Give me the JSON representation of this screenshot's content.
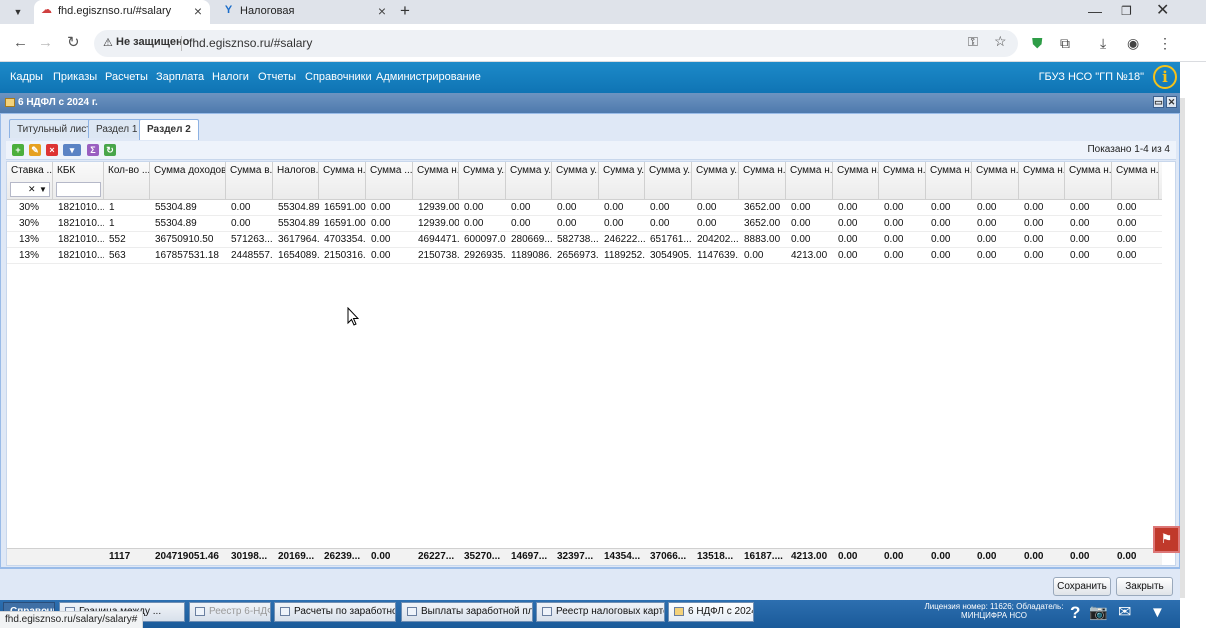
{
  "browser": {
    "tabs": [
      {
        "title": "fhd.egisznso.ru/#salary",
        "active": true
      },
      {
        "title": "Налоговая",
        "active": false
      }
    ],
    "url": "fhd.egisznso.ru/#salary",
    "security_label": "Не защищено",
    "status_url": "fhd.egisznso.ru/salary/salary#"
  },
  "menu": {
    "items": [
      "Кадры",
      "Приказы",
      "Расчеты",
      "Зарплата",
      "Налоги",
      "Отчеты",
      "Справочники",
      "Администрирование"
    ],
    "org": "ГБУЗ НСО \"ГП №18\""
  },
  "panel": {
    "title": "6 НДФЛ с 2024 г.",
    "tabs": [
      "Титульный лист",
      "Раздел 1",
      "Раздел 2"
    ],
    "active_tab": "Раздел 2"
  },
  "toolbar": {
    "shown": "Показано 1-4 из 4"
  },
  "grid": {
    "columns": [
      "Ставка ...",
      "КБК",
      "Кол-во ...",
      "Сумма доходов...",
      "Сумма в...",
      "Налогов...",
      "Сумма н...",
      "Сумма ...",
      "Сумма н...",
      "Сумма у...",
      "Сумма у...",
      "Сумма у...",
      "Сумма у...",
      "Сумма у...",
      "Сумма у...",
      "Сумма н...",
      "Сумма н...",
      "Сумма н...",
      "Сумма н...",
      "Сумма н...",
      "Сумма н...",
      "Сумма н...",
      "Сумма н...",
      "Сумма н..."
    ],
    "rows": [
      [
        "30%",
        "1821010...",
        "1",
        "55304.89",
        "0.00",
        "55304.89",
        "16591.00",
        "0.00",
        "12939.00",
        "0.00",
        "0.00",
        "0.00",
        "0.00",
        "0.00",
        "0.00",
        "3652.00",
        "0.00",
        "0.00",
        "0.00",
        "0.00",
        "0.00",
        "0.00",
        "0.00",
        "0.00"
      ],
      [
        "30%",
        "1821010...",
        "1",
        "55304.89",
        "0.00",
        "55304.89",
        "16591.00",
        "0.00",
        "12939.00",
        "0.00",
        "0.00",
        "0.00",
        "0.00",
        "0.00",
        "0.00",
        "3652.00",
        "0.00",
        "0.00",
        "0.00",
        "0.00",
        "0.00",
        "0.00",
        "0.00",
        "0.00"
      ],
      [
        "13%",
        "1821010...",
        "552",
        "36750910.50",
        "571263....",
        "3617964...",
        "4703354...",
        "0.00",
        "4694471...",
        "600097.00",
        "280669....",
        "582738....",
        "246222....",
        "651761....",
        "204202....",
        "8883.00",
        "0.00",
        "0.00",
        "0.00",
        "0.00",
        "0.00",
        "0.00",
        "0.00",
        "0.00"
      ],
      [
        "13%",
        "1821010...",
        "563",
        "167857531.18",
        "2448557...",
        "1654089...",
        "2150316...",
        "0.00",
        "2150738...",
        "2926935...",
        "1189086...",
        "2656973...",
        "1189252...",
        "3054905...",
        "1147639...",
        "0.00",
        "4213.00",
        "0.00",
        "0.00",
        "0.00",
        "0.00",
        "0.00",
        "0.00",
        "0.00"
      ]
    ],
    "totals": [
      "",
      "",
      "1117",
      "204719051.46",
      "30198...",
      "20169...",
      "26239...",
      "0.00",
      "26227...",
      "35270...",
      "14697...",
      "32397...",
      "14354...",
      "37066...",
      "13518...",
      "16187....",
      "4213.00",
      "0.00",
      "0.00",
      "0.00",
      "0.00",
      "0.00",
      "0.00",
      "0.00"
    ]
  },
  "buttons": {
    "save": "Сохранить",
    "close": "Закрыть"
  },
  "taskbar": {
    "tasks": [
      {
        "label": "Справочник подразд",
        "dim": false
      },
      {
        "label": "Граница между ...",
        "dim": false
      },
      {
        "label": "Реестр 6-НДФЛ",
        "dim": true
      },
      {
        "label": "Расчеты по заработной ...",
        "dim": false
      },
      {
        "label": "Выплаты заработной платы",
        "dim": false
      },
      {
        "label": "Реестр налоговых карточек",
        "dim": false
      },
      {
        "label": "6 НДФЛ с 2024 г.",
        "dim": false
      }
    ],
    "license_line1": "Лицензия номер: 11626; Обладатель:",
    "license_line2": "МИНЦИФРА НСО"
  }
}
